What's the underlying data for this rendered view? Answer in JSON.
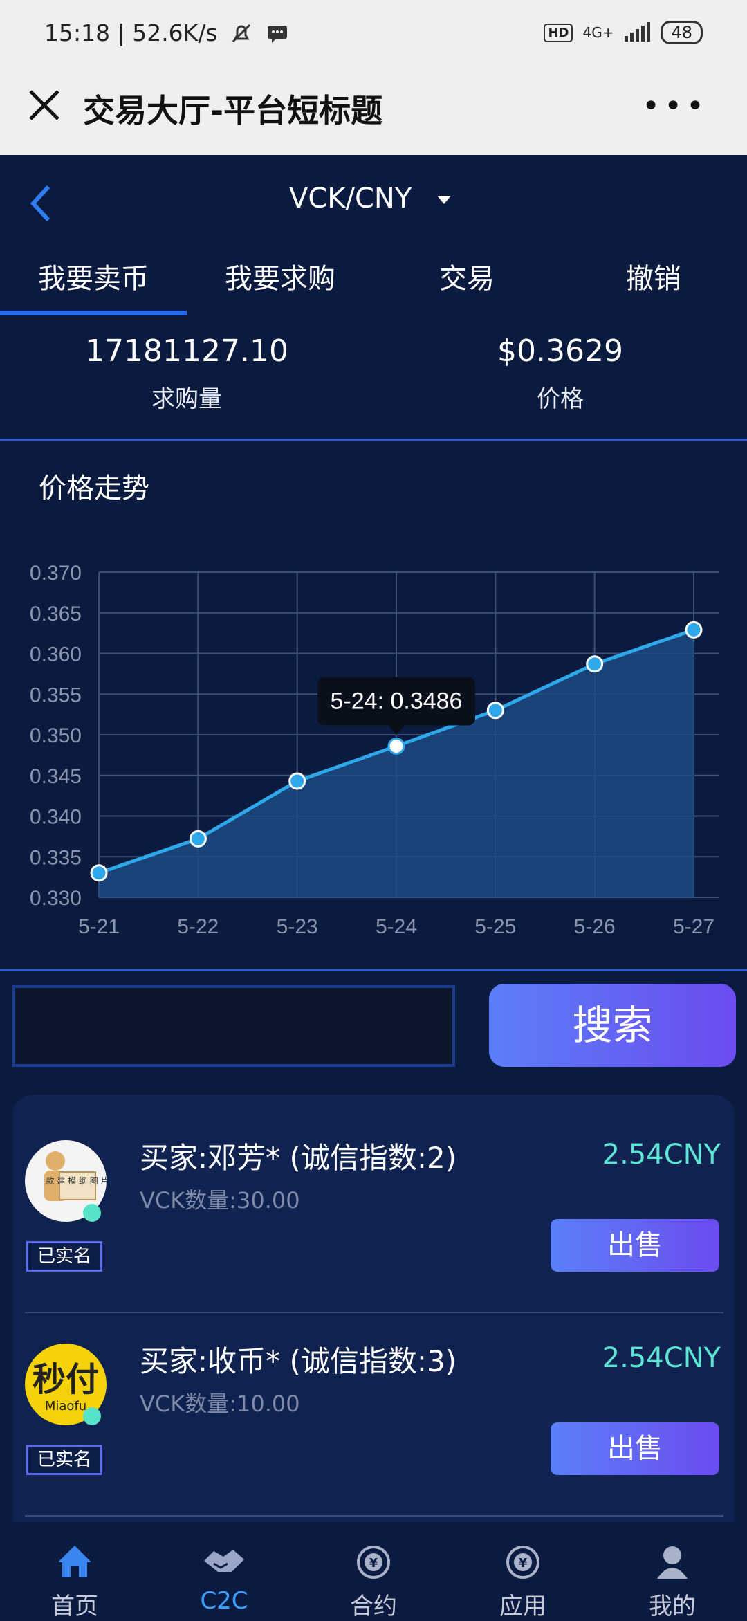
{
  "status_bar": {
    "time": "15:18 | 52.6K/s",
    "network": "4G+",
    "battery": "48",
    "hd_label": "HD"
  },
  "nav": {
    "title": "交易大厅-平台短标题"
  },
  "pair": {
    "title": "VCK/CNY"
  },
  "tabs": [
    {
      "label": "我要卖币",
      "active": true
    },
    {
      "label": "我要求购",
      "active": false
    },
    {
      "label": "交易",
      "active": false
    },
    {
      "label": "撤销",
      "active": false
    }
  ],
  "stats": {
    "volume": {
      "value": "17181127.10",
      "label": "求购量"
    },
    "price": {
      "value": "$0.3629",
      "label": "价格"
    }
  },
  "chart_section": {
    "title": "价格走势"
  },
  "chart_data": {
    "type": "area",
    "categories": [
      "5-21",
      "5-22",
      "5-23",
      "5-24",
      "5-25",
      "5-26",
      "5-27"
    ],
    "values": [
      0.333,
      0.3372,
      0.3443,
      0.3486,
      0.353,
      0.3587,
      0.3629
    ],
    "ylim": [
      0.33,
      0.37
    ],
    "yticks": [
      "0.370",
      "0.365",
      "0.360",
      "0.355",
      "0.350",
      "0.345",
      "0.340",
      "0.335",
      "0.330"
    ],
    "tooltip": "5-24: 0.3486",
    "tooltip_index": 3,
    "grid": true,
    "line_color": "#2ea8ea",
    "fill_color": "#1c4a82"
  },
  "search": {
    "button_label": "搜索",
    "value": ""
  },
  "listings": [
    {
      "buyer": "买家:邓芳* (诚信指数:2)",
      "qty": "VCK数量:30.00",
      "price": "2.54CNY",
      "verified": "已实名",
      "button": "出售",
      "avatar_text": "款 建 模 纲 图 片"
    },
    {
      "buyer": "买家:收币* (诚信指数:3)",
      "qty": "VCK数量:10.00",
      "price": "2.54CNY",
      "verified": "已实名",
      "button": "出售",
      "avatar_text": "秒付",
      "avatar_sub": "Miaofu"
    }
  ],
  "tabbar": [
    {
      "label": "首页",
      "icon": "home-icon",
      "active": false
    },
    {
      "label": "C2C",
      "icon": "handshake-icon",
      "active": true
    },
    {
      "label": "合约",
      "icon": "yuan-coin-icon",
      "active": false
    },
    {
      "label": "应用",
      "icon": "yuan-coin-icon",
      "active": false
    },
    {
      "label": "我的",
      "icon": "user-icon",
      "active": false
    }
  ]
}
